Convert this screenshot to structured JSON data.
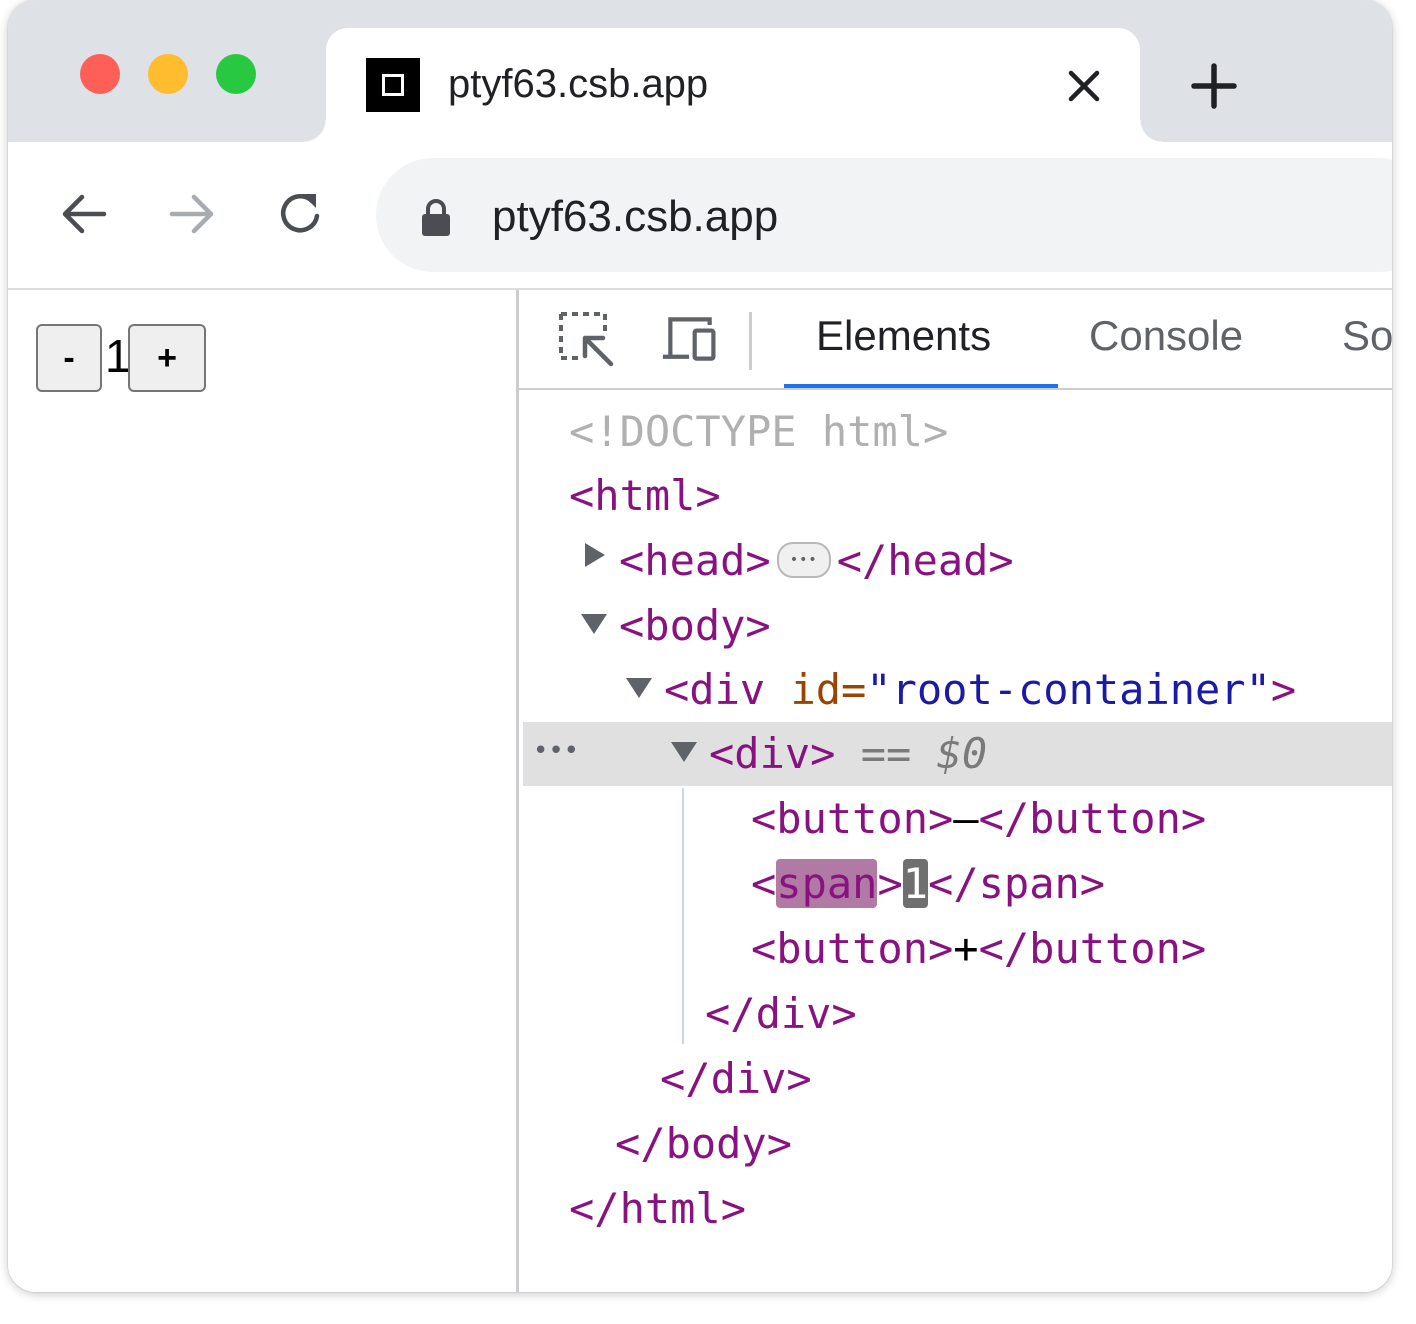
{
  "browser": {
    "tab": {
      "title": "ptyf63.csb.app"
    },
    "address_bar": {
      "url": "ptyf63.csb.app"
    }
  },
  "page": {
    "minus_label": "-",
    "count": "1",
    "plus_label": "+"
  },
  "devtools": {
    "tabs": [
      "Elements",
      "Console",
      "So"
    ],
    "active_tab": "Elements",
    "dom": {
      "doctype": "<!DOCTYPE html>",
      "html_open": "<html>",
      "head_open": "<head>",
      "head_close": "</head>",
      "body_open": "<body>",
      "div_root_open_start": "<div ",
      "div_root_attr_name": "id=",
      "div_root_attr_value": "\"root-container\"",
      "div_root_open_end": ">",
      "div_open": "<div>",
      "selected_marker": "== $0",
      "button1_open": "<button>",
      "button1_text": "–",
      "button1_close": "</button>",
      "span_lt": "<",
      "span_name": "span",
      "span_gt": ">",
      "span_text": "1",
      "span_close": "</span>",
      "button2_open": "<button>",
      "button2_text": "+",
      "button2_close": "</button>",
      "div_close": "</div>",
      "div_root_close": "</div>",
      "body_close": "</body>",
      "html_close": "</html>"
    }
  }
}
